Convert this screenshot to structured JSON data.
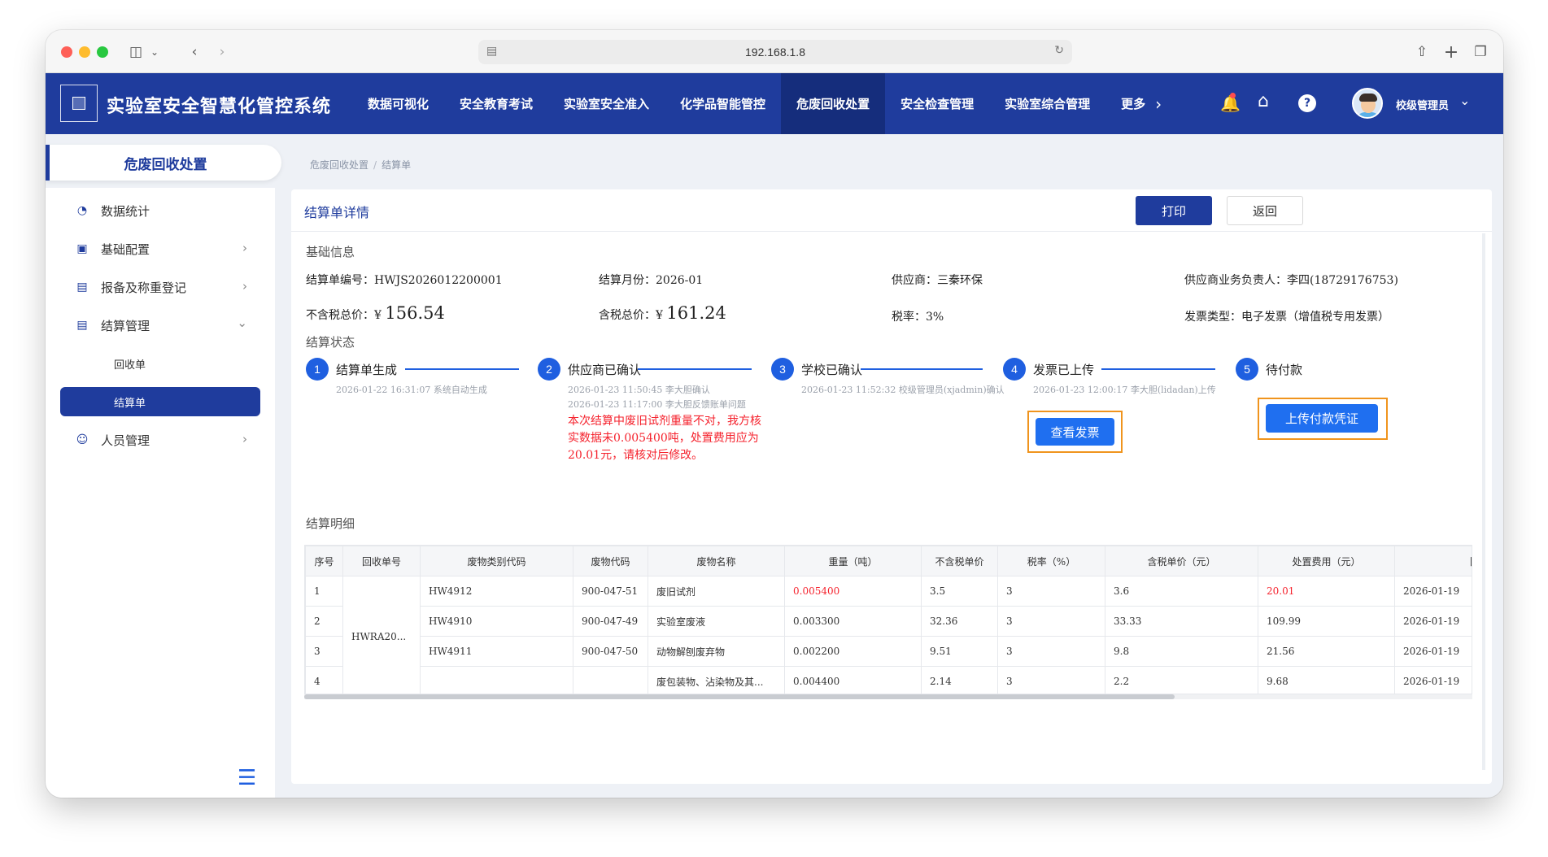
{
  "browser": {
    "url": "192.168.1.8"
  },
  "app": {
    "title": "实验室安全智慧化管控系统",
    "nav": [
      "数据可视化",
      "安全教育考试",
      "实验室安全准入",
      "化学品智能管控",
      "危废回收处置",
      "安全检查管理",
      "实验室综合管理",
      "更多"
    ],
    "nav_active_index": 4,
    "user_name": "校级管理员"
  },
  "sidebar": {
    "title": "危废回收处置",
    "items": [
      {
        "label": "数据统计",
        "icon": "pie-chart-icon"
      },
      {
        "label": "基础配置",
        "icon": "monitor-icon"
      },
      {
        "label": "报备及称重登记",
        "icon": "document-icon"
      },
      {
        "label": "结算管理",
        "icon": "document-icon"
      },
      {
        "label": "人员管理",
        "icon": "user-icon"
      }
    ],
    "sub_items": [
      "回收单",
      "结算单"
    ],
    "active_sub": "结算单"
  },
  "breadcrumb": [
    "危废回收处置",
    "结算单"
  ],
  "card": {
    "title": "结算单详情",
    "print_label": "打印",
    "back_label": "返回"
  },
  "basic": {
    "section": "基础信息",
    "order_no_label": "结算单编号：",
    "order_no": "HWJS2026012200001",
    "month_label": "结算月份：",
    "month": "2026-01",
    "supplier_label": "供应商：",
    "supplier": "三秦环保",
    "contact_label": "供应商业务负责人：",
    "contact": "李四(18729176753)",
    "pretax_label": "不含税总价：",
    "currency": "¥",
    "pretax_total": "156.54",
    "tax_total_label": "含税总价：",
    "tax_total": "161.24",
    "tax_rate_label": "税率：",
    "tax_rate": "3%",
    "invoice_type_label": "发票类型：",
    "invoice_type": "电子发票（增值税专用发票）"
  },
  "status": {
    "section": "结算状态",
    "steps": [
      {
        "no": "1",
        "title": "结算单生成",
        "meta": [
          "2026-01-22 16:31:07 系统自动生成"
        ]
      },
      {
        "no": "2",
        "title": "供应商已确认",
        "meta": [
          "2026-01-23 11:50:45 李大胆确认",
          "2026-01-23 11:17:00 李大胆反馈账单问题"
        ],
        "note": "本次结算中废旧试剂重量不对，我方核实数据未0.005400吨，处置费用应为20.01元，请核对后修改。"
      },
      {
        "no": "3",
        "title": "学校已确认",
        "meta": [
          "2026-01-23 11:52:32 校级管理员(xjadmin)确认"
        ]
      },
      {
        "no": "4",
        "title": "发票已上传",
        "meta": [
          "2026-01-23 12:00:17 李大胆(lidadan)上传"
        ],
        "button": "查看发票"
      },
      {
        "no": "5",
        "title": "待付款",
        "button": "上传付款凭证"
      }
    ]
  },
  "detail": {
    "section": "结算明细",
    "columns": [
      "序号",
      "回收单号",
      "废物类别代码",
      "废物代码",
      "废物名称",
      "重量（吨）",
      "不含税单价",
      "税率（%）",
      "含税单价（元）",
      "处置费用（元）",
      "回"
    ],
    "merged_order_no": "HWRA20...",
    "rows": [
      {
        "no": "1",
        "category": "HW4912",
        "code": "900-047-51",
        "name": "废旧试剂",
        "weight": "0.005400",
        "unit_price": "3.5",
        "tax": "3",
        "tax_price": "3.6",
        "fee": "20.01",
        "date": "2026-01-19"
      },
      {
        "no": "2",
        "category": "HW4910",
        "code": "900-047-49",
        "name": "实验室废液",
        "weight": "0.003300",
        "unit_price": "32.36",
        "tax": "3",
        "tax_price": "33.33",
        "fee": "109.99",
        "date": "2026-01-19"
      },
      {
        "no": "3",
        "category": "HW4911",
        "code": "900-047-50",
        "name": "动物解刨废弃物",
        "weight": "0.002200",
        "unit_price": "9.51",
        "tax": "3",
        "tax_price": "9.8",
        "fee": "21.56",
        "date": "2026-01-19"
      },
      {
        "no": "4",
        "category": "",
        "code": "",
        "name": "废包装物、沾染物及其...",
        "weight": "0.004400",
        "unit_price": "2.14",
        "tax": "3",
        "tax_price": "2.2",
        "fee": "9.68",
        "date": "2026-01-19"
      }
    ]
  },
  "colors": {
    "primary": "#1f3c9d",
    "step_blue": "#1f5fe0",
    "highlight": "#f0941d",
    "error": "#f5222d"
  }
}
